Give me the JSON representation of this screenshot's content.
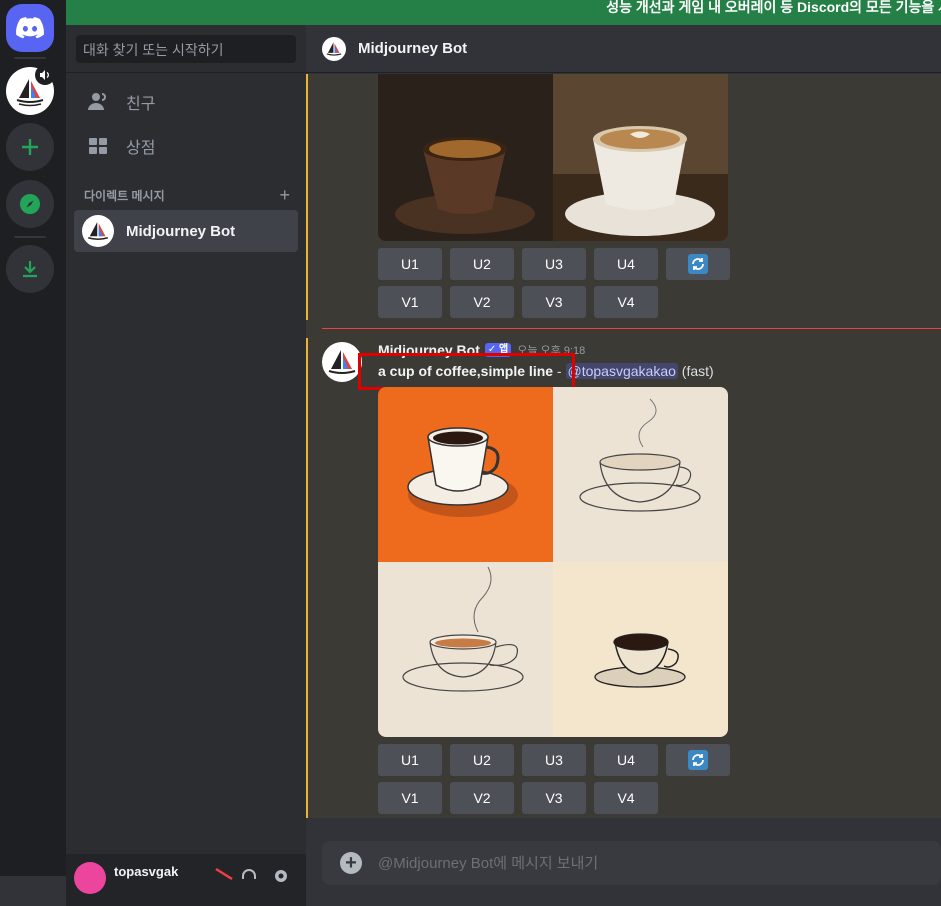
{
  "banner": {
    "text": "성능 개선과 게임 내 오버레이 등 Discord의 모든 기능을 사"
  },
  "sidebar": {
    "search_placeholder": "대화 찾기 또는 시작하기",
    "nav": [
      {
        "label": "친구",
        "icon": "friends-icon"
      },
      {
        "label": "상점",
        "icon": "shop-icon"
      }
    ],
    "dm_header": "다이렉트 메시지",
    "dm_add": "+",
    "dm_items": [
      {
        "label": "Midjourney Bot"
      }
    ],
    "user": {
      "name": "topasvgak"
    }
  },
  "chat": {
    "header_title": "Midjourney Bot",
    "upscale_buttons": [
      "U1",
      "U2",
      "U3",
      "U4"
    ],
    "variation_buttons": [
      "V1",
      "V2",
      "V3",
      "V4"
    ],
    "message": {
      "author": "Midjourney Bot",
      "badge": "✓ 앱",
      "timestamp": "오늘 오후 9:18",
      "prompt": "a cup of coffee,simple line",
      "dash": " - ",
      "mention": "@topasvgakakao",
      "mode": "(fast)"
    },
    "composer_placeholder": "@Midjourney Bot에 메시지 보내기"
  },
  "colors": {
    "discord_blurple": "#5865f2",
    "banner_green": "#248046",
    "highlight_red": "#e00000",
    "mention_gold": "#f0b232"
  }
}
